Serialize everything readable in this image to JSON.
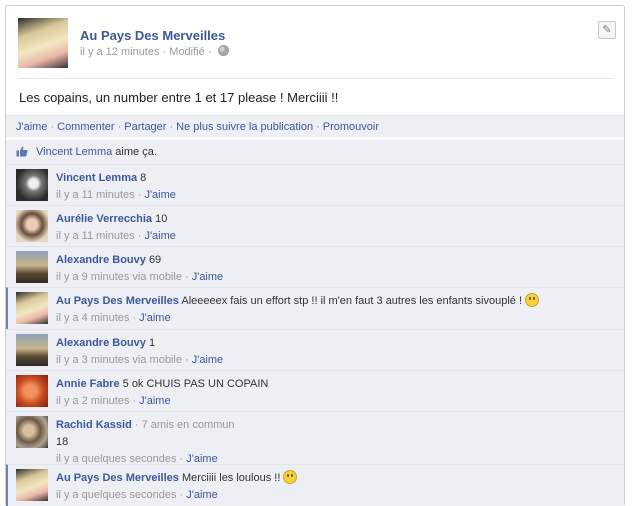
{
  "post": {
    "page_name": "Au Pays Des Merveilles",
    "time": "il y a 12 minutes",
    "modified": "Modifié",
    "text": "Les copains, un number entre 1 et 17 please ! Merciiii !!"
  },
  "actions": {
    "like": "J'aime",
    "comment": "Commenter",
    "share": "Partager",
    "unfollow": "Ne plus suivre la publication",
    "promote": "Promouvoir"
  },
  "likes": {
    "name": "Vincent Lemma",
    "suffix": "aime ça."
  },
  "comments": [
    {
      "author": "Vincent Lemma",
      "text": "8",
      "meta": "il y a 11 minutes · ",
      "like": "J'aime"
    },
    {
      "author": "Aurélie Verrecchia",
      "text": "10",
      "meta": "il y a 11 minutes · ",
      "like": "J'aime"
    },
    {
      "author": "Alexandre Bouvy",
      "text": "69",
      "meta": "il y a 9 minutes via mobile · ",
      "like": "J'aime"
    },
    {
      "author": "Au Pays Des Merveilles",
      "text": "Aleeeeex fais un effort stp !! il m'en faut 3 autres les enfants sivouplé !",
      "meta": "il y a 4 minutes · ",
      "like": "J'aime"
    },
    {
      "author": "Alexandre Bouvy",
      "text": "1",
      "meta": "il y a 3 minutes via mobile · ",
      "like": "J'aime"
    },
    {
      "author": "Annie Fabre",
      "text": "5 ok CHUIS PAS UN COPAIN",
      "meta": "il y a 2 minutes · ",
      "like": "J'aime"
    },
    {
      "author": "Rachid Kassid",
      "mutual": " · 7 amis en commun",
      "text": "18",
      "meta": "il y a quelques secondes · ",
      "like": "J'aime"
    },
    {
      "author": "Au Pays Des Merveilles",
      "text": "Merciiii les loulous !!",
      "meta": "il y a quelques secondes · ",
      "like": "J'aime"
    }
  ],
  "icons": {
    "globe": "globe-icon",
    "edit": "pencil-icon",
    "like": "thumbs-up-icon",
    "smiley": "smiley-icon"
  },
  "colors": {
    "link": "#3b5998",
    "muted": "#999999",
    "panel": "#edeff4"
  }
}
